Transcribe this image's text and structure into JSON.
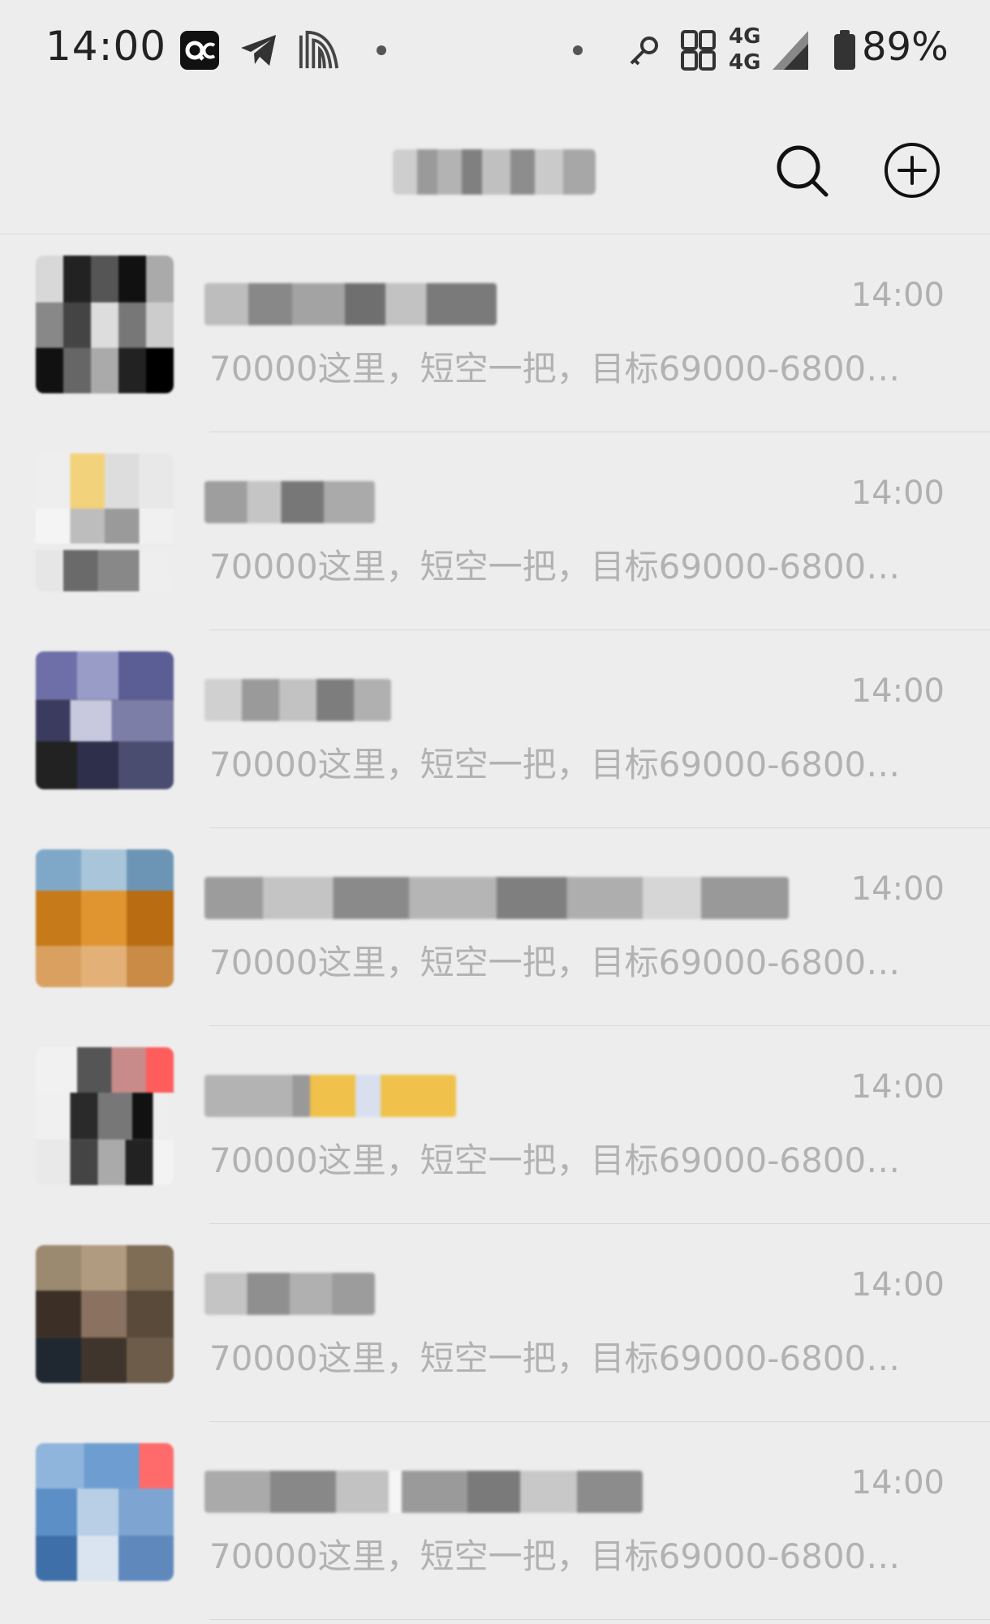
{
  "status_bar": {
    "time": "14:00",
    "battery_percent": "89%",
    "network_label_top": "4G",
    "network_label_bottom": "4G"
  },
  "header": {
    "title": ""
  },
  "chats": [
    {
      "time": "14:00",
      "preview": "70000这里，短空一把，目标69000-6800…"
    },
    {
      "time": "14:00",
      "preview": "70000这里，短空一把，目标69000-6800…"
    },
    {
      "time": "14:00",
      "preview": "70000这里，短空一把，目标69000-6800…"
    },
    {
      "time": "14:00",
      "preview": "70000这里，短空一把，目标69000-6800…"
    },
    {
      "time": "14:00",
      "preview": "70000这里，短空一把，目标69000-6800…"
    },
    {
      "time": "14:00",
      "preview": "70000这里，短空一把，目标69000-6800…"
    },
    {
      "time": "14:00",
      "preview": "70000这里，短空一把，目标69000-6800…"
    }
  ],
  "icons": {
    "search": "search-icon",
    "add": "add-circle-icon"
  },
  "colors": {
    "background": "#ededed",
    "preview_text": "#b2b2b2",
    "time_text": "#b0b0b0"
  }
}
